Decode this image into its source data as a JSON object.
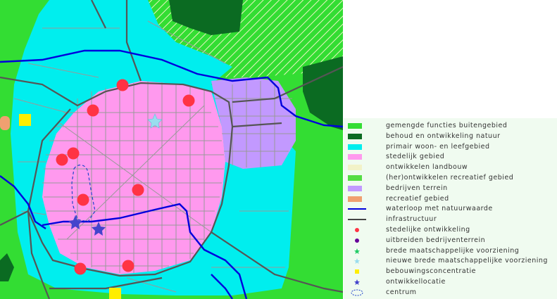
{
  "colors": {
    "buitengebied": "#33dd33",
    "natuur": "#0b6b22",
    "wonen": "#00eeee",
    "stedelijk": "#ff99ee",
    "landbouw": "#f2f2c8",
    "recreatief": "#55dd44",
    "bedrijven": "#c299ff",
    "recreatief_gebied": "#f0a070",
    "waterloop": "#0000dd",
    "infrastructuur": "#444444",
    "dot_red": "#ff3344",
    "dot_purple": "#660099",
    "star_green": "#22cc66",
    "star_lightblue": "#99ddee",
    "square_yellow": "#ffee00",
    "star_blue": "#4444cc",
    "centrum_outline": "#2244cc",
    "street_grey": "#999999"
  },
  "legend": [
    {
      "icon": "green-fill-swatch",
      "label": "gemengde functies buitengebied"
    },
    {
      "icon": "darkgreen-fill-swatch",
      "label": "behoud en ontwikkeling natuur"
    },
    {
      "icon": "cyan-fill-swatch",
      "label": "primair woon- en leefgebied"
    },
    {
      "icon": "pink-fill-swatch",
      "label": "stedelijk gebied"
    },
    {
      "icon": "cream-fill-swatch",
      "label": "ontwikkelen landbouw"
    },
    {
      "icon": "lightgreen-fill-swatch",
      "label": "(her)ontwikkelen recreatief gebied"
    },
    {
      "icon": "lilac-fill-swatch",
      "label": "bedrijven terrein"
    },
    {
      "icon": "orange-fill-swatch",
      "label": "recreatief gebied"
    },
    {
      "icon": "blue-line-swatch",
      "label": "waterloop met natuurwaarde"
    },
    {
      "icon": "black-line-swatch",
      "label": "infrastructuur"
    },
    {
      "icon": "red-dot-icon",
      "label": "stedelijke ontwikkeling"
    },
    {
      "icon": "purple-dot-icon",
      "label": "uitbreiden bedrijventerrein"
    },
    {
      "icon": "green-star-icon",
      "label": "brede maatschappelijke voorziening"
    },
    {
      "icon": "lightblue-star-icon",
      "label": "nieuwe brede maatschappelijke voorziening"
    },
    {
      "icon": "yellow-square-icon",
      "label": "bebouwingsconcentratie"
    },
    {
      "icon": "blue-star-icon",
      "label": "ontwikkellocatie"
    },
    {
      "icon": "dashed-outline-icon",
      "label": "centrum"
    }
  ]
}
